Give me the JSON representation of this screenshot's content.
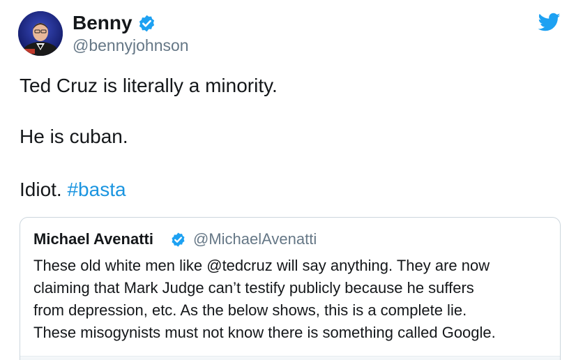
{
  "tweet": {
    "author_name": "Benny",
    "handle": "@bennyjohnson",
    "lines": [
      "Ted Cruz is literally a minority.",
      "He is cuban.",
      "Idiot."
    ],
    "hashtag": "#basta"
  },
  "quoted": {
    "author_name": "Michael Avenatti",
    "handle": "@MichaelAvenatti",
    "lines": [
      "These old white men like @tedcruz will say anything. They are now",
      "claiming that Mark Judge can’t testify publicly because he suffers",
      "from depression, etc. As the below shows, this is a complete lie.",
      "These misogynists must not know there is something called Google."
    ]
  },
  "icons": {
    "verified": "verified-badge-icon",
    "brand": "twitter-bird-icon"
  },
  "colors": {
    "brand_blue": "#1da1f2",
    "hashtag": "#1b95e0",
    "secondary_text": "#657786",
    "border": "#ccd6dd"
  }
}
